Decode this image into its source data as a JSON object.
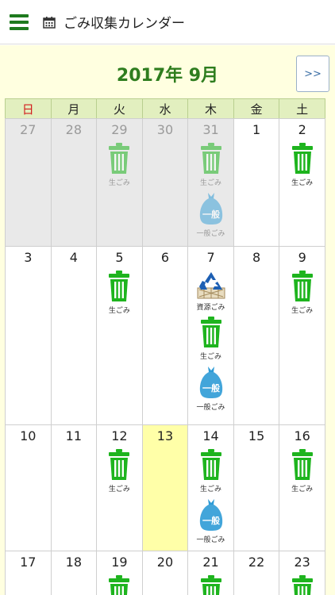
{
  "app": {
    "title": "ごみ収集カレンダー"
  },
  "month": {
    "title": "2017年 9月",
    "next_label": ">>"
  },
  "weekdays": [
    "日",
    "月",
    "火",
    "水",
    "木",
    "金",
    "土"
  ],
  "waste_types": {
    "burnable": {
      "label": "生ごみ",
      "icon": "trash-bin-icon",
      "color": "#1eb41e"
    },
    "general": {
      "label": "一般ごみ",
      "icon": "garbage-bag-icon",
      "color": "#2e9bd6",
      "bag_text": "一般"
    },
    "resource": {
      "label": "資源ごみ",
      "icon": "recycle-icon",
      "color": "#1d5fb3"
    }
  },
  "weeks": [
    [
      {
        "day": "27",
        "other": true,
        "items": []
      },
      {
        "day": "28",
        "other": true,
        "items": []
      },
      {
        "day": "29",
        "other": true,
        "items": [
          "burnable"
        ]
      },
      {
        "day": "30",
        "other": true,
        "items": []
      },
      {
        "day": "31",
        "other": true,
        "items": [
          "burnable",
          "general"
        ]
      },
      {
        "day": "1",
        "items": []
      },
      {
        "day": "2",
        "items": [
          "burnable"
        ]
      }
    ],
    [
      {
        "day": "3",
        "items": []
      },
      {
        "day": "4",
        "items": []
      },
      {
        "day": "5",
        "items": [
          "burnable"
        ]
      },
      {
        "day": "6",
        "items": []
      },
      {
        "day": "7",
        "items": [
          "resource",
          "burnable",
          "general"
        ]
      },
      {
        "day": "8",
        "items": []
      },
      {
        "day": "9",
        "items": [
          "burnable"
        ]
      }
    ],
    [
      {
        "day": "10",
        "items": []
      },
      {
        "day": "11",
        "items": []
      },
      {
        "day": "12",
        "items": [
          "burnable"
        ]
      },
      {
        "day": "13",
        "today": true,
        "items": []
      },
      {
        "day": "14",
        "items": [
          "burnable",
          "general"
        ]
      },
      {
        "day": "15",
        "items": []
      },
      {
        "day": "16",
        "items": [
          "burnable"
        ]
      }
    ],
    [
      {
        "day": "17",
        "items": []
      },
      {
        "day": "18",
        "items": []
      },
      {
        "day": "19",
        "items": [
          "burnable"
        ]
      },
      {
        "day": "20",
        "items": []
      },
      {
        "day": "21",
        "items": [
          "burnable"
        ]
      },
      {
        "day": "22",
        "items": []
      },
      {
        "day": "23",
        "items": [
          "burnable"
        ]
      }
    ]
  ]
}
